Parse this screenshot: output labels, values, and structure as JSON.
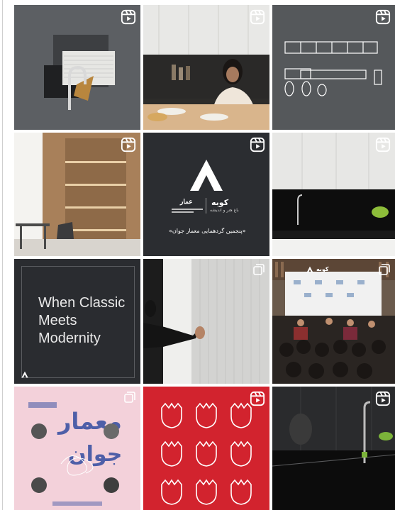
{
  "colors": {
    "grey_tile": "#5a5d61",
    "dark_tile": "#2a2c30",
    "red_tile": "#d2232e",
    "pink_tile": "#f3d1da",
    "light_tile": "#e9e9e7"
  },
  "tiles": {
    "t5": {
      "brand_fa": "کوبه",
      "brand_fa_sub": "باغ هنر و اندیشه",
      "partner": "عمار",
      "caption_fa": "«پنجمین گردهمایی معمار جوان»"
    },
    "t7": {
      "lines": [
        "When Classic",
        "Meets",
        "Modernity"
      ]
    },
    "t9": {
      "banner_fa": "کوبه"
    },
    "t10": {
      "title_fa_1": "معمار",
      "title_fa_2": "جوان"
    }
  },
  "icons": {
    "reels": "reels-icon",
    "multiple": "carousel-icon",
    "brand": "a-logo-icon"
  }
}
